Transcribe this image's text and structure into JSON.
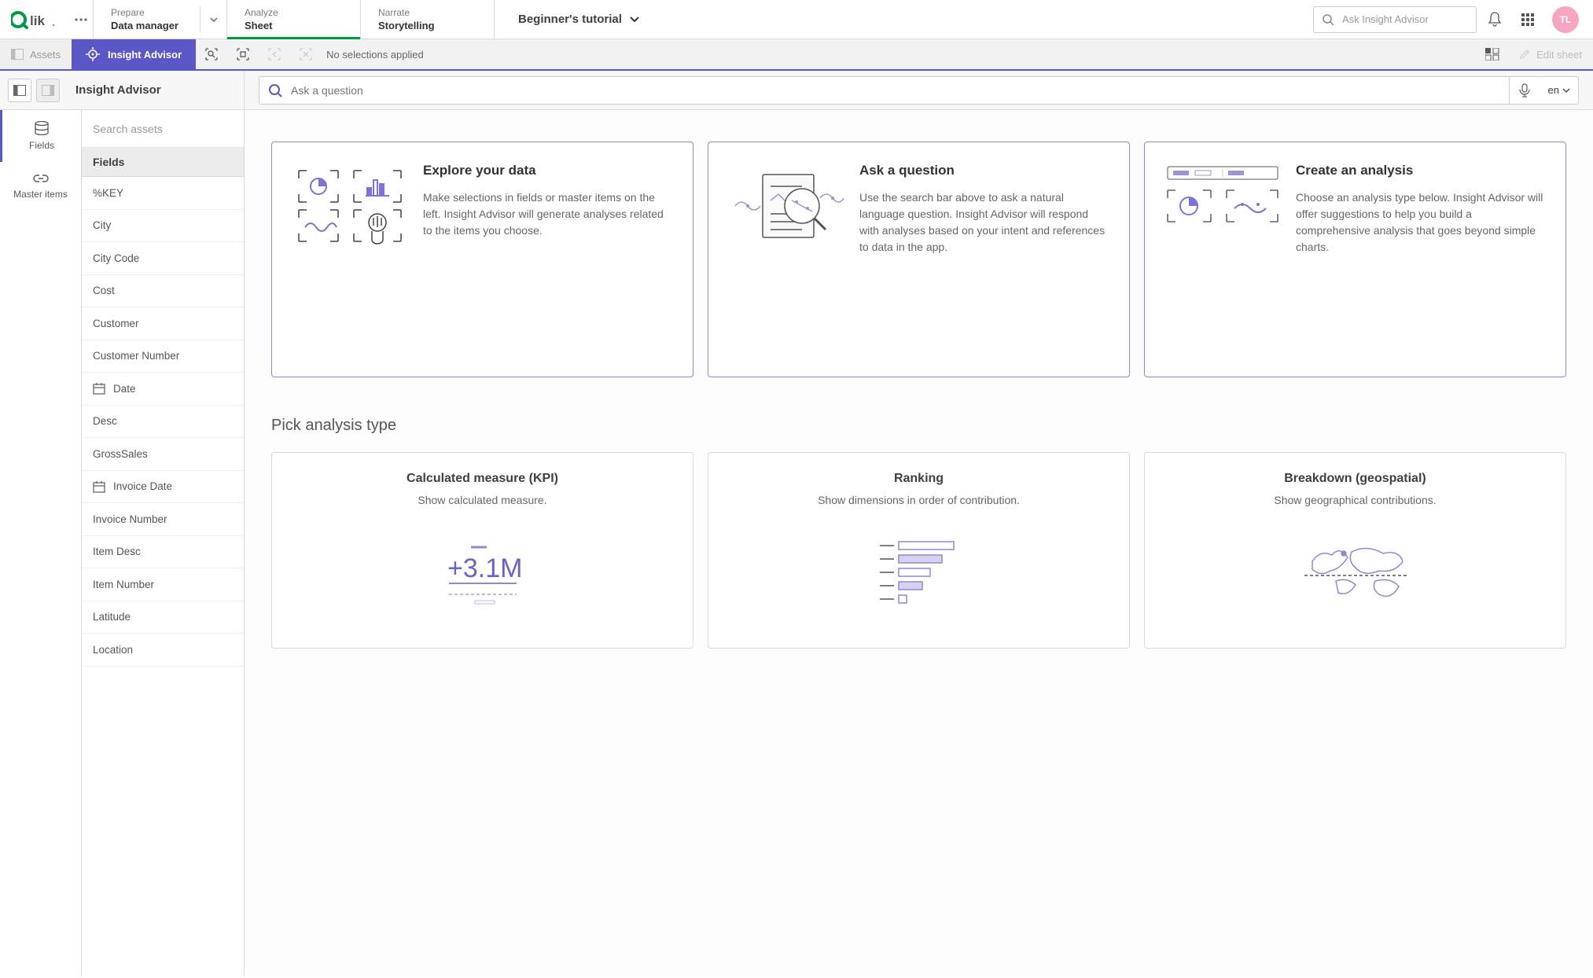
{
  "topnav": {
    "tabs": [
      {
        "sup": "Prepare",
        "sub": "Data manager"
      },
      {
        "sup": "Analyze",
        "sub": "Sheet"
      },
      {
        "sup": "Narrate",
        "sub": "Storytelling"
      }
    ],
    "app_title": "Beginner's tutorial",
    "search_placeholder": "Ask Insight Advisor",
    "avatar_initials": "TL"
  },
  "secondbar": {
    "assets_label": "Assets",
    "ia_label": "Insight Advisor",
    "no_selections": "No selections applied",
    "edit_sheet": "Edit sheet"
  },
  "thirdbar": {
    "title": "Insight Advisor",
    "question_placeholder": "Ask a question",
    "lang": "en"
  },
  "lefttabs": {
    "fields": "Fields",
    "master": "Master items"
  },
  "assets": {
    "search_placeholder": "Search assets",
    "header": "Fields",
    "items": [
      {
        "label": "%KEY",
        "icon": ""
      },
      {
        "label": "City",
        "icon": ""
      },
      {
        "label": "City Code",
        "icon": ""
      },
      {
        "label": "Cost",
        "icon": ""
      },
      {
        "label": "Customer",
        "icon": ""
      },
      {
        "label": "Customer Number",
        "icon": ""
      },
      {
        "label": "Date",
        "icon": "date"
      },
      {
        "label": "Desc",
        "icon": ""
      },
      {
        "label": "GrossSales",
        "icon": ""
      },
      {
        "label": "Invoice Date",
        "icon": "date"
      },
      {
        "label": "Invoice Number",
        "icon": ""
      },
      {
        "label": "Item Desc",
        "icon": ""
      },
      {
        "label": "Item Number",
        "icon": ""
      },
      {
        "label": "Latitude",
        "icon": ""
      },
      {
        "label": "Location",
        "icon": ""
      }
    ]
  },
  "cards": [
    {
      "title": "Explore your data",
      "body": "Make selections in fields or master items on the left. Insight Advisor will generate analyses related to the items you choose."
    },
    {
      "title": "Ask a question",
      "body": "Use the search bar above to ask a natural language question. Insight Advisor will respond with analyses based on your intent and references to data in the app."
    },
    {
      "title": "Create an analysis",
      "body": "Choose an analysis type below. Insight Advisor will offer suggestions to help you build a comprehensive analysis that goes beyond simple charts."
    }
  ],
  "analysis": {
    "section_title": "Pick analysis type",
    "types": [
      {
        "title": "Calculated measure (KPI)",
        "desc": "Show calculated measure."
      },
      {
        "title": "Ranking",
        "desc": "Show dimensions in order of contribution."
      },
      {
        "title": "Breakdown (geospatial)",
        "desc": "Show geographical contributions."
      }
    ]
  }
}
